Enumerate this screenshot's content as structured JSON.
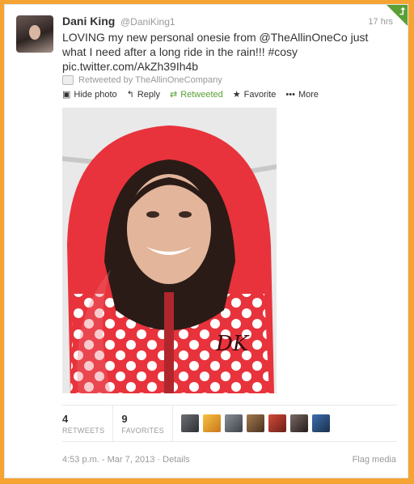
{
  "tweet": {
    "author_name": "Dani King",
    "author_handle": "@DaniKing1",
    "time_ago": "17 hrs",
    "text_lines": [
      "LOVING my new personal onesie from @TheAllinOneCo just",
      "what I need after a long ride in the rain!!! #cosy",
      "pic.twitter.com/AkZh39Ih4b"
    ],
    "retweeted_by": "Retweeted by TheAllinOneCompany"
  },
  "actions": {
    "hide_photo": "Hide photo",
    "reply": "Reply",
    "retweeted": "Retweeted",
    "favorite": "Favorite",
    "more": "More"
  },
  "stats": {
    "retweets_count": "4",
    "retweets_label": "RETWEETS",
    "favorites_count": "9",
    "favorites_label": "FAVORITES"
  },
  "footer": {
    "timestamp": "4:53 p.m. - Mar 7, 2013",
    "separator": "·",
    "details": "Details",
    "flag_media": "Flag media"
  },
  "colors": {
    "frame": "#f5a433",
    "retweet_green": "#5aa035",
    "hood_red": "#e8333c"
  },
  "icons": {
    "corner": "retweet-corner-icon",
    "photo": "photo-icon",
    "reply": "reply-icon",
    "retweet": "retweet-icon",
    "favorite": "star-icon",
    "more": "more-dots-icon"
  }
}
